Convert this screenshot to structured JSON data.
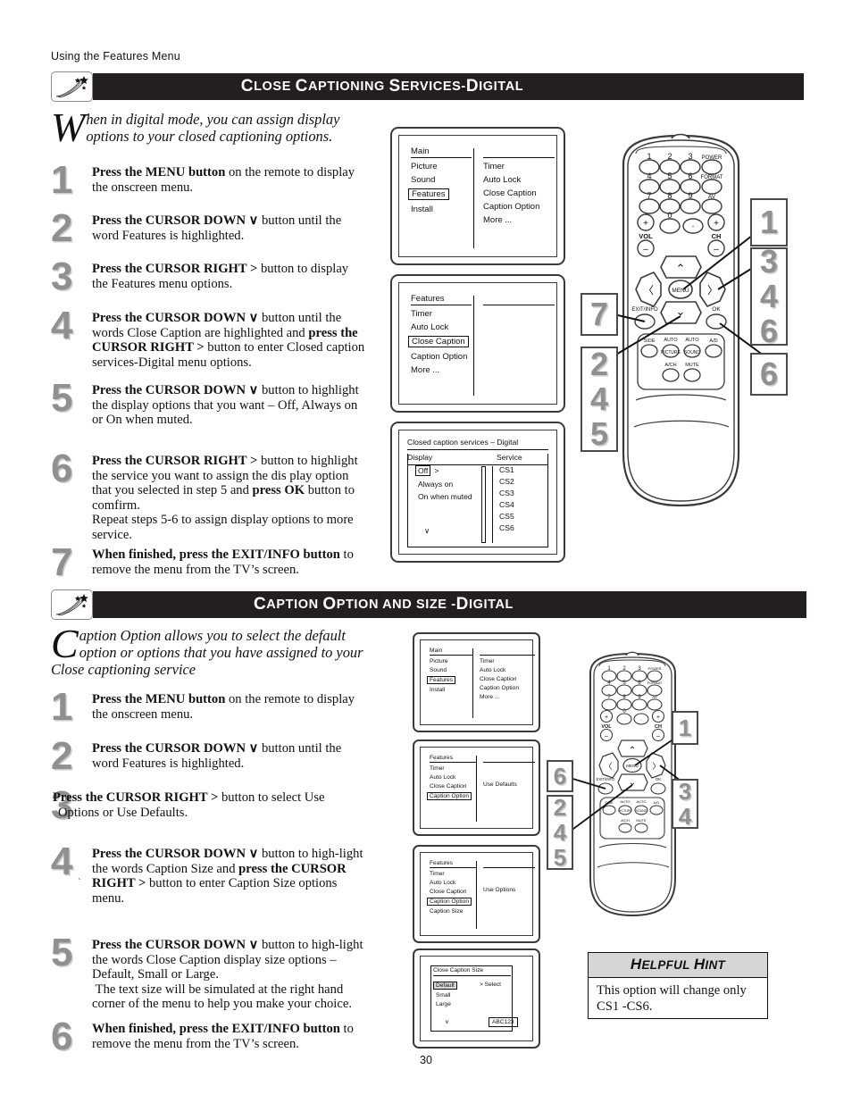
{
  "running_head": "Using the Features Menu",
  "page_number": "30",
  "sections": [
    {
      "id": "close-captioning-services-digital",
      "banner_icon": "shooting-star-icon",
      "title_parts": [
        {
          "t": "C",
          "caps": true
        },
        {
          "t": "LOSE ",
          "caps": false
        },
        {
          "t": "C",
          "caps": true
        },
        {
          "t": "APTIONING ",
          "caps": false
        },
        {
          "t": "S",
          "caps": true
        },
        {
          "t": "ERVICES-",
          "caps": false
        },
        {
          "t": "D",
          "caps": true
        },
        {
          "t": "IGITAL",
          "caps": false
        }
      ],
      "title_plain": "CLOSE CAPTIONING SERVICES-DIGITAL",
      "intro_dropcap": "W",
      "intro_text": "hen in digital mode, you can assign display options to your closed captioning options.",
      "steps": [
        {
          "num": "1",
          "html": "<b>Press the MENU button</b> on the remote to display the onscreen menu."
        },
        {
          "num": "2",
          "html": "<b>Press the CURSOR DOWN  ∨</b>  button until the word Features is highlighted."
        },
        {
          "num": "3",
          "html": "<b>Press the CURSOR RIGHT  &gt;</b> button to display the Features menu options."
        },
        {
          "num": "4",
          "html": "<b>Press the CURSOR DOWN  ∨</b> button until the words Close Caption are highlighted and <b>press the CURSOR RIGHT  &gt;</b> button to enter Closed caption services-Digital menu options."
        },
        {
          "num": "5",
          "html": "<b>Press the CURSOR DOWN  ∨</b> button to highlight the display options that you want – Off, Always on or On when muted."
        },
        {
          "num": "6",
          "html": "<b>Press the CURSOR RIGHT  &gt;</b> button to highlight the service you want to assign the dis play option that you selected in step 5 and <b>press OK</b> button to comfirm.<br>Repeat steps 5-6 to assign display options to more service."
        },
        {
          "num": "7",
          "html": "<b>When finished, press the EXIT/INFO button</b> to remove the menu from the TV’s screen."
        }
      ]
    },
    {
      "id": "caption-option-and-size-digital",
      "banner_icon": "shooting-star-icon",
      "title_plain": "CAPTION OPTION AND SIZE -DIGITAL",
      "intro_dropcap": "C",
      "intro_text": "aption Option allows you to select the default option or options that you have assigned to your Close captioning service",
      "steps": [
        {
          "num": "1",
          "html": "<b>Press the MENU button</b> on the remote to display the onscreen menu."
        },
        {
          "num": "2",
          "html": "<b>Press the CURSOR DOWN  ∨</b>  button until the word Features is highlighted."
        },
        {
          "num": "3",
          "html": "<b> Press the CURSOR RIGHT  &gt;</b> button to select Use Options or Use Defaults."
        },
        {
          "num": "4",
          "html": "<b>Press the CURSOR DOWN  ∨</b>  button to high-light the words Caption Size and <b>press the CURSOR RIGHT  &gt;</b> button to enter Caption Size options menu."
        },
        {
          "num": "5",
          "html": "<b>Press the CURSOR DOWN  ∨</b>  button to high-light the words Close Caption display size options – Default, Small or Large.<br>&nbsp;The text size will be simulated at the right hand corner of the menu to help you make your choice."
        },
        {
          "num": "6",
          "html": "<b>When finished, press the EXIT/INFO button</b> to remove the menu from the TV’s screen."
        }
      ]
    }
  ],
  "osd_screens": {
    "main_menu": {
      "left_header": "Main",
      "left_items": [
        "Picture",
        "Sound",
        "Features",
        "Install"
      ],
      "left_selected": "Features",
      "right_items": [
        "Timer",
        "Auto Lock",
        "Close Caption",
        "Caption Option",
        "More ..."
      ]
    },
    "features_menu": {
      "left_header": "Features",
      "left_items": [
        "Timer",
        "Auto Lock",
        "Close Caption",
        "Caption Option",
        "More ..."
      ],
      "left_selected": "Close Caption",
      "right_items": []
    },
    "cc_services_digital": {
      "title": "Closed caption services – Digital",
      "col1_header": "Display",
      "col2_header": "Service",
      "display_options": [
        "Off",
        "Always on",
        "On when muted"
      ],
      "display_selected": "Off",
      "display_arrow": ">",
      "down_arrow": "∨",
      "services": [
        "CS1",
        "CS2",
        "CS3",
        "CS4",
        "CS5",
        "CS6"
      ]
    },
    "features_caption_option_defaults": {
      "left_header": "Features",
      "left_items": [
        "Timer",
        "Auto Lock",
        "Close Caption",
        "Caption Option"
      ],
      "left_selected": "Caption Option",
      "right_value": "Use Defaults"
    },
    "features_caption_option_options": {
      "left_header": "Features",
      "left_items": [
        "Timer",
        "Auto Lock",
        "Close Caption",
        "Caption Option",
        "Caption Size"
      ],
      "left_selected": "Caption Option",
      "right_value": "Use Options"
    },
    "close_caption_size": {
      "title": "Close Caption Size",
      "options": [
        "Default",
        "Small",
        "Large"
      ],
      "selected": "Default",
      "select_label": "> Select",
      "down_arrow": "∨",
      "sample_text": "ABC123"
    }
  },
  "remote": {
    "keypad_rows": [
      [
        "1",
        "2",
        "3",
        "POWER"
      ],
      [
        "4",
        "5",
        "6",
        "FORMAT"
      ],
      [
        "7",
        "8",
        "9",
        "AV"
      ]
    ],
    "zero_row": [
      "0",
      "·"
    ],
    "vol_label": "VOL",
    "ch_label": "CH",
    "plus": "+",
    "minus": "–",
    "menu_label": "MENU",
    "ok_label": "OK",
    "exit_label": "EXIT/INFO",
    "up_arrow": "∧",
    "down_arrow": "∨",
    "left_arrow": "〈",
    "right_arrow": "〉",
    "bottom_row1": [
      "SIDE",
      "AUTO PICTURE",
      "AUTO SOUND",
      "A/D"
    ],
    "bottom_row2": [
      "A/CH",
      "MUTE"
    ]
  },
  "callouts": {
    "top_remote": [
      {
        "labels": [
          "1"
        ]
      },
      {
        "labels": [
          "3",
          "4",
          "6"
        ]
      },
      {
        "labels": [
          "7"
        ]
      },
      {
        "labels": [
          "2",
          "4",
          "5"
        ]
      },
      {
        "labels": [
          "6"
        ]
      }
    ],
    "bottom_remote": [
      {
        "labels": [
          "1"
        ]
      },
      {
        "labels": [
          "3",
          "4"
        ]
      },
      {
        "labels": [
          "6"
        ]
      },
      {
        "labels": [
          "2",
          "4",
          "5"
        ]
      }
    ]
  },
  "helpful_hint": {
    "title_plain": "HELPFUL HINT",
    "body": "This option will change only CS1 -CS6."
  }
}
